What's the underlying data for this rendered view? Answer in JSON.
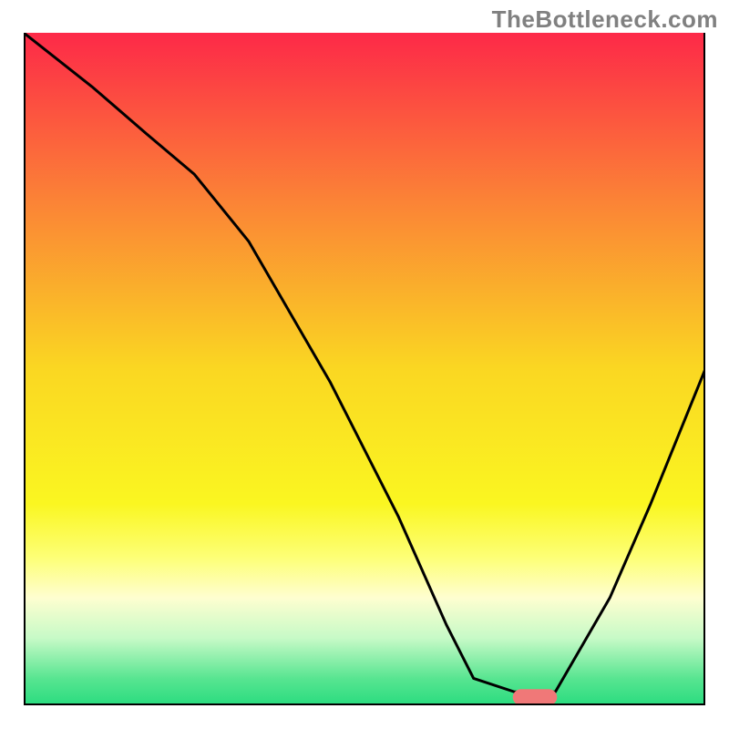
{
  "watermark": "TheBottleneck.com",
  "chart_data": {
    "type": "line",
    "title": "",
    "xlabel": "",
    "ylabel": "",
    "xlim": [
      0,
      100
    ],
    "ylim": [
      0,
      100
    ],
    "grid": false,
    "legend": false,
    "background_gradient": {
      "type": "vertical",
      "stops": [
        {
          "offset": 0.0,
          "color": "#fd2948"
        },
        {
          "offset": 0.25,
          "color": "#fb8336"
        },
        {
          "offset": 0.5,
          "color": "#fad722"
        },
        {
          "offset": 0.7,
          "color": "#faf621"
        },
        {
          "offset": 0.78,
          "color": "#fdff76"
        },
        {
          "offset": 0.84,
          "color": "#fefed0"
        },
        {
          "offset": 0.9,
          "color": "#c7fac7"
        },
        {
          "offset": 0.96,
          "color": "#58e591"
        },
        {
          "offset": 1.0,
          "color": "#2adc7f"
        }
      ]
    },
    "series": [
      {
        "name": "curve",
        "color": "#000000",
        "stroke_width": 3,
        "x": [
          0,
          10,
          18,
          25,
          33,
          45,
          55,
          62,
          66,
          72,
          78,
          86,
          92,
          100
        ],
        "y": [
          100,
          92,
          85,
          79,
          69,
          48,
          28,
          12,
          4,
          2,
          2,
          16,
          30,
          50
        ]
      }
    ],
    "marker": {
      "name": "optimal-region",
      "shape": "rounded-rect",
      "color": "#f07878",
      "x_center": 75,
      "y_center": 1.2,
      "width": 6.5,
      "height": 2.4
    }
  },
  "colors": {
    "frame": "#000000",
    "curve": "#000000",
    "marker": "#f07878",
    "watermark": "#808080"
  }
}
